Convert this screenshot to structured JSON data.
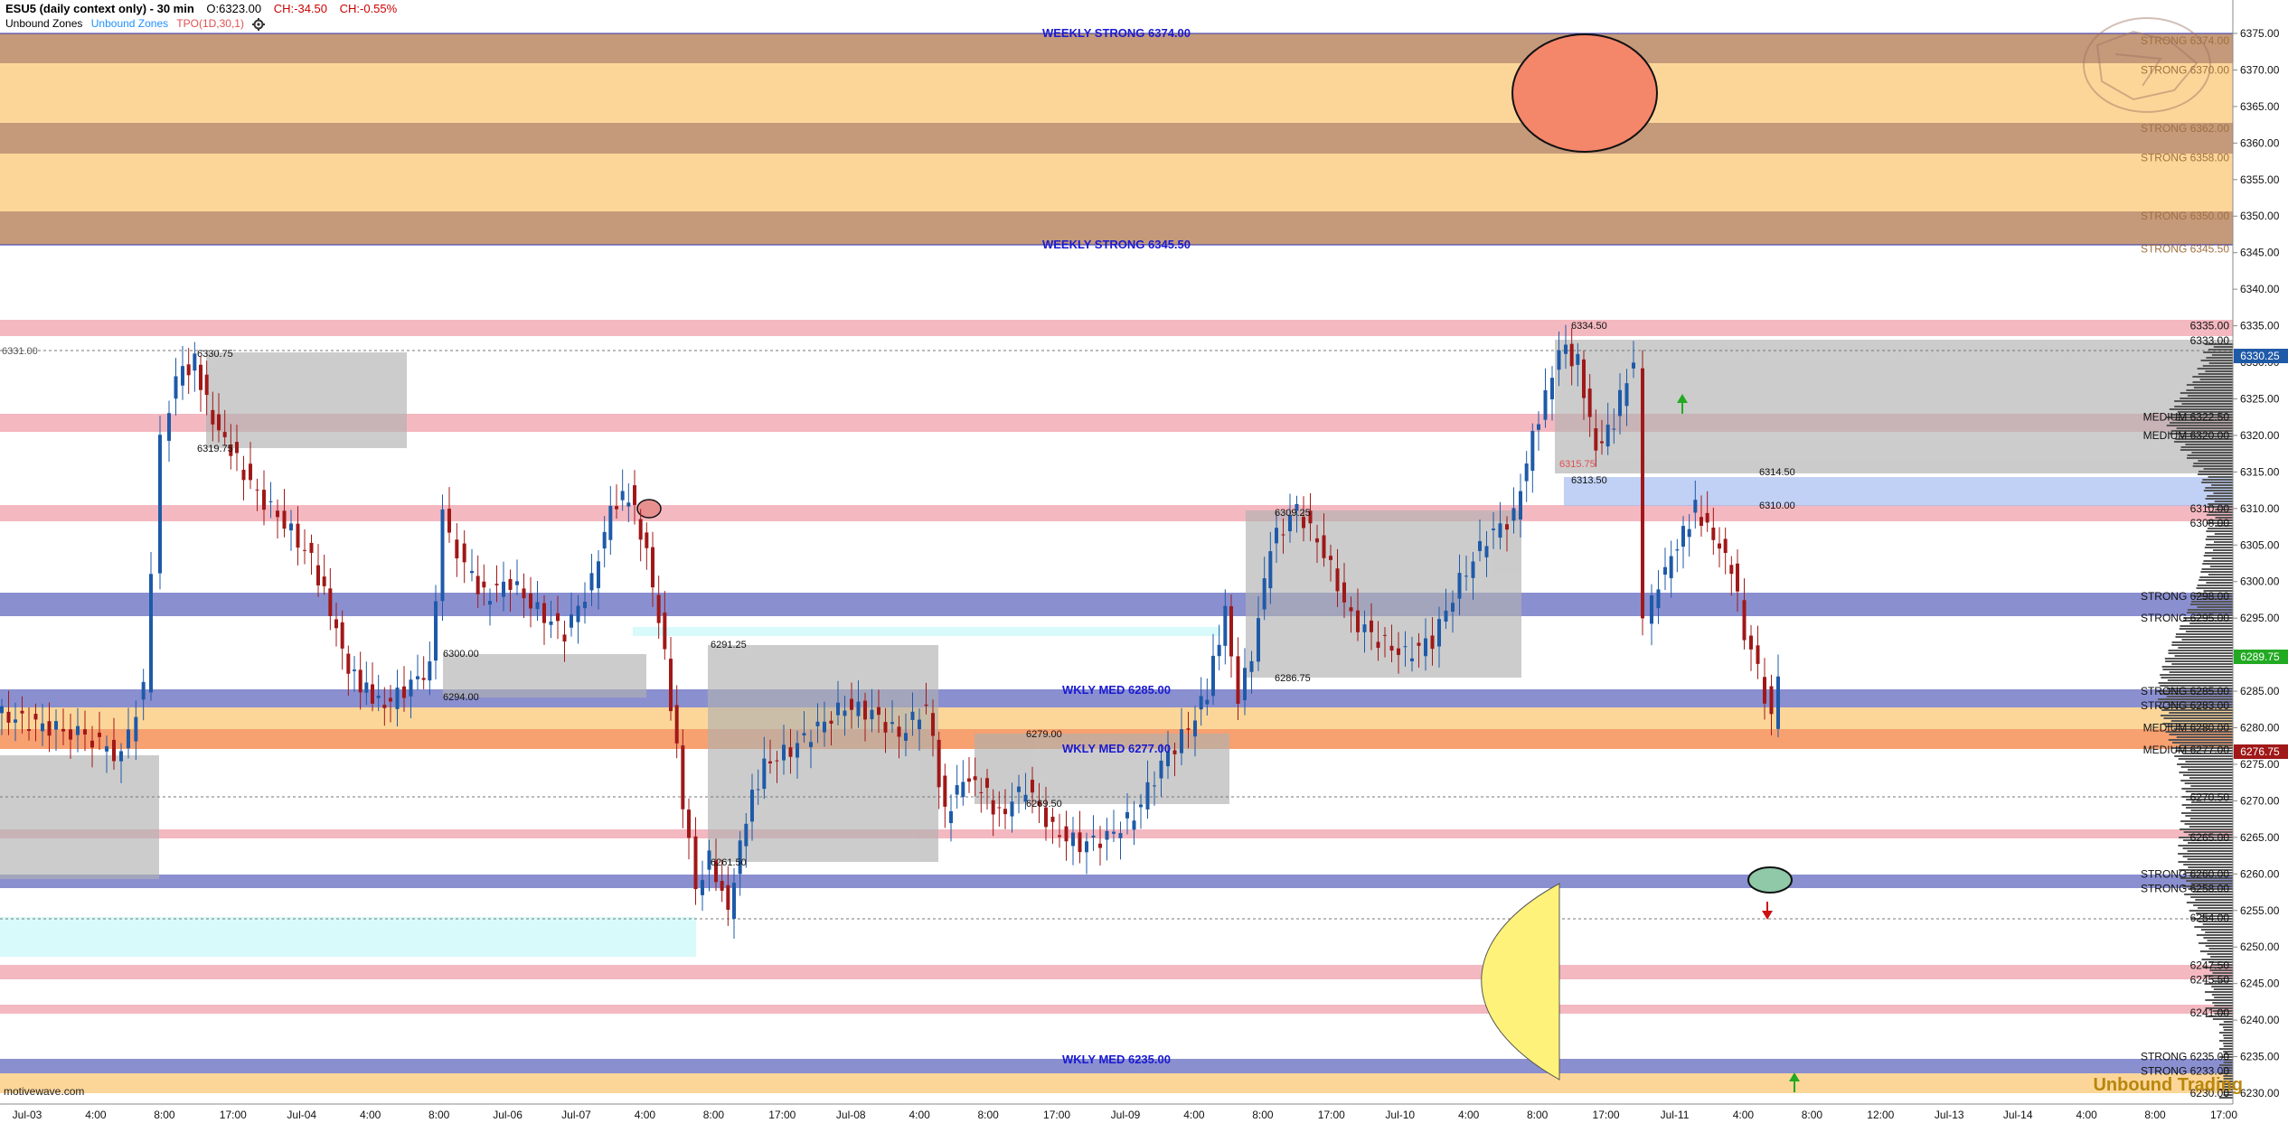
{
  "header": {
    "symbol": "ESU5 (daily context only) - 30 min",
    "open": "O:6323.00",
    "change": "CH:-34.50",
    "change_pct": "CH:-0.55%",
    "indicators": [
      "Unbound Zones",
      "Unbound Zones",
      "TPO(1D,30,1)"
    ]
  },
  "colors": {
    "weekly_band": "#f7c98a",
    "weekly_edge": "#c49a7a",
    "strong_blue": "#8a8fd0",
    "pink": "#f4b8c0",
    "orange": "#f7a070",
    "up": "#1e5aa8",
    "down": "#a01818"
  },
  "price_axis": {
    "min": 6230,
    "max": 6375,
    "ticks": [
      "6375.00",
      "6370.00",
      "6365.00",
      "6360.00",
      "6355.00",
      "6350.00",
      "6345.00",
      "6340.00",
      "6335.00",
      "6330.00",
      "6325.00",
      "6320.00",
      "6315.00",
      "6310.00",
      "6305.00",
      "6300.00",
      "6295.00",
      "6290.00",
      "6285.00",
      "6280.00",
      "6275.00",
      "6270.00",
      "6265.00",
      "6260.00",
      "6255.00",
      "6250.00",
      "6245.00",
      "6240.00",
      "6235.00",
      "6230.00"
    ],
    "last_price": "6330.25",
    "current_price": "6289.75",
    "prev_price": "6276.75"
  },
  "time_axis": [
    "Jul-03",
    "4:00",
    "8:00",
    "17:00",
    "Jul-04",
    "4:00",
    "8:00",
    "Jul-06",
    "Jul-07",
    "4:00",
    "8:00",
    "17:00",
    "Jul-08",
    "4:00",
    "8:00",
    "17:00",
    "Jul-09",
    "4:00",
    "8:00",
    "17:00",
    "Jul-10",
    "4:00",
    "8:00",
    "17:00",
    "Jul-11",
    "4:00",
    "8:00",
    "12:00",
    "Jul-13",
    "Jul-14",
    "4:00",
    "8:00",
    "17:00"
  ],
  "zone_labels": {
    "weekly_strong_top": "WEEKLY STRONG 6374.00",
    "weekly_strong_mid": "WEEKLY STRONG 6345.50",
    "wkly_med_6285": "WKLY MED 6285.00",
    "wkly_med_6277": "WKLY MED 6277.00",
    "wkly_med_6235": "WKLY MED 6235.00"
  },
  "right_labels": [
    "STRONG 6374.00",
    "STRONG 6370.00",
    "STRONG 6362.00",
    "STRONG 6358.00",
    "STRONG 6350.00",
    "STRONG 6345.50",
    "6335.00",
    "6333.00",
    "MEDIUM 6322.50",
    "MEDIUM 6320.00",
    "6310.00",
    "6308.00",
    "STRONG 6298.00",
    "STRONG 6295.00",
    "STRONG 6285.00",
    "STRONG 6283.00",
    "MEDIUM 6280.00",
    "MEDIUM 6277.00",
    "6270.50",
    "6265.00",
    "STRONG 6260.00",
    "STRONG 6258.00",
    "6254.00",
    "6247.50",
    "6245.50",
    "6241.00",
    "STRONG 6235.00",
    "STRONG 6233.00",
    "6230.00"
  ],
  "annotations": [
    "6331.00",
    "6330.75",
    "6319.75",
    "6334.50",
    "6313.50",
    "6315.75",
    "6314.50",
    "6310.00",
    "6309.25",
    "6300.00",
    "6294.00",
    "6291.25",
    "6286.75",
    "6279.00",
    "6269.50",
    "6261.50"
  ],
  "footer": {
    "watermark": "motivewave.com",
    "brand": "Unbound Trading"
  }
}
